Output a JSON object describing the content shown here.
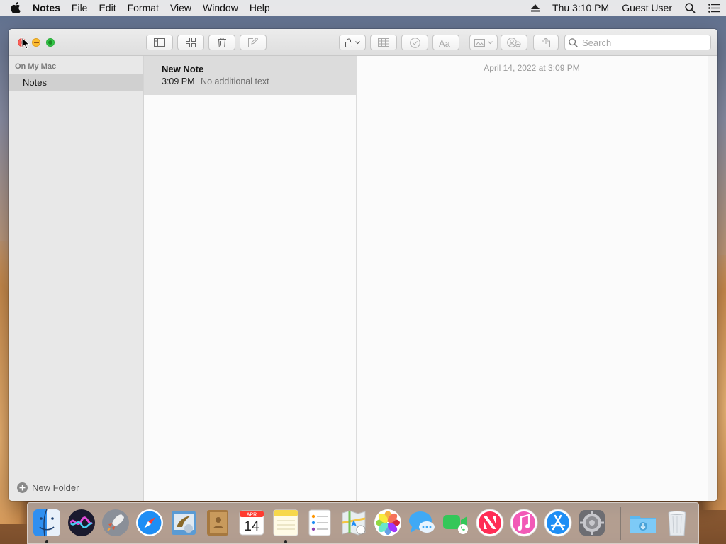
{
  "menubar": {
    "app_name": "Notes",
    "menus": [
      "File",
      "Edit",
      "Format",
      "View",
      "Window",
      "Help"
    ],
    "clock": "Thu 3:10 PM",
    "user": "Guest User"
  },
  "toolbar": {
    "search_placeholder": "Search"
  },
  "sidebar": {
    "section_header": "On My Mac",
    "folders": [
      {
        "label": "Notes",
        "selected": true
      }
    ],
    "new_folder_label": "New Folder"
  },
  "note_list": {
    "notes": [
      {
        "title": "New Note",
        "time": "3:09 PM",
        "preview": "No additional text",
        "selected": true
      }
    ]
  },
  "editor": {
    "date": "April 14, 2022 at 3:09 PM"
  },
  "dock": {
    "calendar": {
      "month": "APR",
      "day": "14"
    },
    "apps": [
      "finder-icon",
      "siri-icon",
      "launchpad-icon",
      "safari-icon",
      "mail-icon",
      "contacts-icon",
      "calendar-icon",
      "notes-icon",
      "reminders-icon",
      "maps-icon",
      "photos-icon",
      "messages-icon",
      "facetime-icon",
      "news-icon",
      "itunes-icon",
      "app-store-icon",
      "system-preferences-icon",
      "downloads-icon",
      "trash-icon"
    ]
  },
  "colors": {
    "close": "#fc5f57",
    "minimize": "#fdbc2e",
    "maximize": "#34c84a",
    "selection": "#d0d0d0"
  }
}
